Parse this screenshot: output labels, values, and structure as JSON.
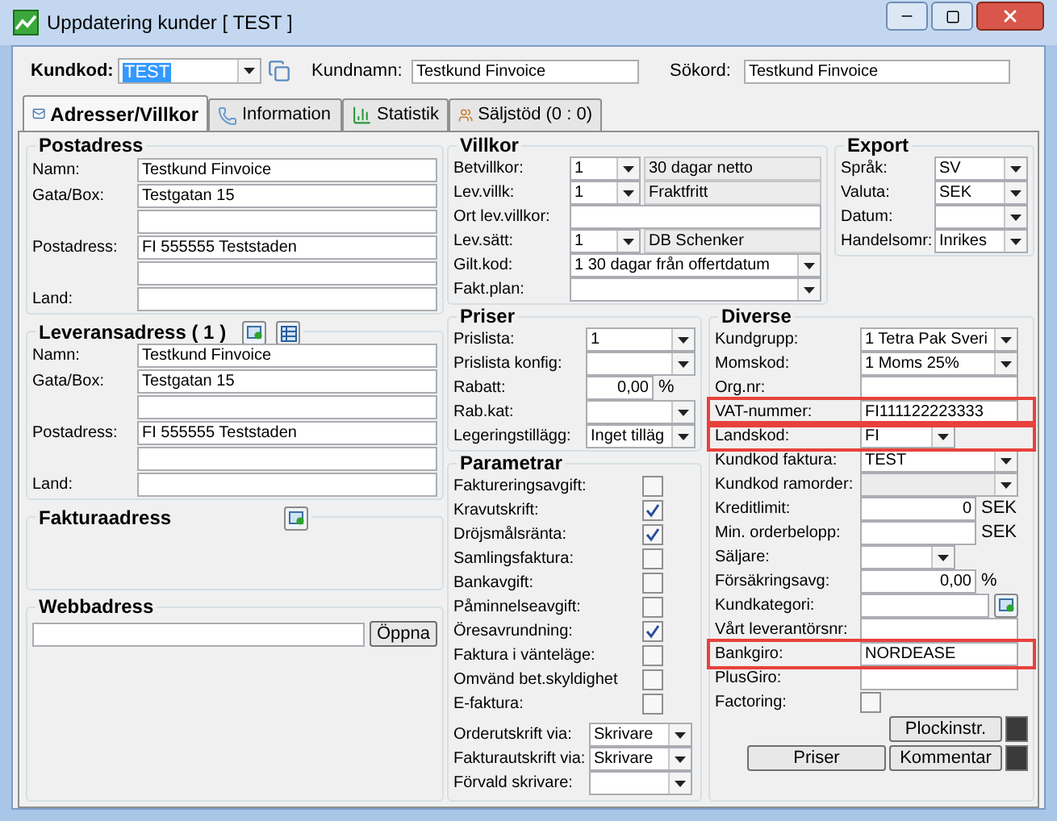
{
  "window": {
    "title": "Uppdatering kunder [ TEST ]"
  },
  "header": {
    "kundkod": {
      "label": "Kundkod:",
      "value": "TEST"
    },
    "kundnamn": {
      "label": "Kundnamn:",
      "value": "Testkund Finvoice"
    },
    "sokord": {
      "label": "Sökord:",
      "value": "Testkund Finvoice"
    }
  },
  "tabs": [
    {
      "label": "Adresser/Villkor",
      "selected": true,
      "kind": "mail"
    },
    {
      "label": "Information",
      "selected": false,
      "kind": "phone"
    },
    {
      "label": "Statistik",
      "selected": false,
      "kind": "chart"
    },
    {
      "label": "Säljstöd (0 : 0)",
      "selected": false,
      "kind": "people"
    }
  ],
  "postadress": {
    "title": "Postadress",
    "rows": [
      {
        "label": "Namn:",
        "value": "Testkund Finvoice"
      },
      {
        "label": "Gata/Box:",
        "value": "Testgatan 15"
      },
      {},
      {
        "label": "Postadress:",
        "value": "FI 555555 Teststaden"
      },
      {},
      {
        "label": "Land:"
      }
    ]
  },
  "leveransadress": {
    "title": "Leveransadress ( 1 )",
    "rows": [
      {
        "label": "Namn:",
        "value": "Testkund Finvoice"
      },
      {
        "label": "Gata/Box:",
        "value": "Testgatan 15"
      },
      {},
      {
        "label": "Postadress:",
        "value": "FI 555555 Teststaden"
      },
      {},
      {
        "label": "Land:"
      }
    ]
  },
  "fakturaadress": {
    "title": "Fakturaadress"
  },
  "webbadress": {
    "title": "Webbadress",
    "button": "Öppna"
  },
  "villkor": {
    "title": "Villkor",
    "rows": [
      {
        "kind": "code",
        "label": "Betvillkor:",
        "value": "1",
        "text": "30 dagar netto"
      },
      {
        "kind": "code",
        "label": "Lev.villk:",
        "value": "1",
        "text": "Fraktfritt"
      },
      {
        "kind": "text",
        "label": "Ort lev.villkor:"
      },
      {
        "kind": "code",
        "label": "Lev.sätt:",
        "value": "1",
        "text": "DB Schenker"
      },
      {
        "kind": "combo",
        "label": "Gilt.kod:",
        "value": "1 30 dagar från offertdatum"
      },
      {
        "kind": "combo",
        "label": "Fakt.plan:"
      }
    ]
  },
  "export": {
    "title": "Export",
    "rows": [
      {
        "kind": "combo",
        "label": "Språk:",
        "value": "SV"
      },
      {
        "kind": "combo",
        "label": "Valuta:",
        "value": "SEK"
      },
      {
        "kind": "combo",
        "label": "Datum:"
      },
      {
        "kind": "combo",
        "label": "Handelsomr:",
        "value": "Inrikes"
      }
    ]
  },
  "priser": {
    "title": "Priser",
    "rows": [
      {
        "kind": "combo",
        "label": "Prislista:",
        "value": "1"
      },
      {
        "kind": "combo",
        "label": "Prislista konfig:"
      },
      {
        "kind": "number",
        "label": "Rabatt:",
        "value": "0,00",
        "unit": "%"
      },
      {
        "kind": "combo",
        "label": "Rab.kat:"
      },
      {
        "kind": "combo",
        "label": "Legeringstillägg:",
        "value": "Inget tilläg"
      }
    ]
  },
  "parametrar": {
    "title": "Parametrar",
    "rows": [
      {
        "kind": "checkbox",
        "label": "Faktureringsavgift:",
        "checked": false
      },
      {
        "kind": "checkbox",
        "label": "Kravutskrift:",
        "checked": true
      },
      {
        "kind": "checkbox",
        "label": "Dröjsmålsränta:",
        "checked": true
      },
      {
        "kind": "checkbox",
        "label": "Samlingsfaktura:",
        "checked": false
      },
      {
        "kind": "checkbox",
        "label": "Bankavgift:",
        "checked": false
      },
      {
        "kind": "checkbox",
        "label": "Påminnelseavgift:",
        "checked": false
      },
      {
        "kind": "checkbox",
        "label": "Öresavrundning:",
        "checked": true
      },
      {
        "kind": "checkbox",
        "label": "Faktura i vänteläge:",
        "checked": false
      },
      {
        "kind": "checkbox",
        "label": "Omvänd bet.skyldighet",
        "checked": false
      },
      {
        "kind": "checkbox",
        "label": "E-faktura:",
        "checked": false
      }
    ],
    "printers": [
      {
        "kind": "combo",
        "label": "Orderutskrift via:",
        "value": "Skrivare"
      },
      {
        "kind": "combo",
        "label": "Fakturautskrift via:",
        "value": "Skrivare"
      },
      {
        "kind": "combo",
        "label": "Förvald skrivare:"
      }
    ]
  },
  "diverse": {
    "title": "Diverse",
    "rows": [
      {
        "kind": "combo",
        "label": "Kundgrupp:",
        "value": "1 Tetra Pak Sveri",
        "highlighted": false
      },
      {
        "kind": "combo",
        "label": "Momskod:",
        "value": "1 Moms 25%",
        "highlighted": false
      },
      {
        "kind": "text",
        "label": "Org.nr:",
        "highlighted": false
      },
      {
        "kind": "text",
        "label": "VAT-nummer:",
        "value": "FI111122223333",
        "highlighted": true
      },
      {
        "kind": "shortcombo",
        "label": "Landskod:",
        "value": "FI",
        "highlighted": true
      },
      {
        "kind": "combo",
        "label": "Kundkod faktura:",
        "value": "TEST",
        "highlighted": false
      },
      {
        "kind": "disabledcombo",
        "label": "Kundkod ramorder:",
        "highlighted": false
      },
      {
        "kind": "number",
        "label": "Kreditlimit:",
        "value": "0",
        "unit": "SEK",
        "highlighted": false
      },
      {
        "kind": "number",
        "label": "Min. orderbelopp:",
        "unit": "SEK",
        "highlighted": false
      },
      {
        "kind": "shortcombo",
        "label": "Säljare:",
        "highlighted": false
      },
      {
        "kind": "number",
        "label": "Försäkringsavg:",
        "value": "0,00",
        "unit": "%",
        "highlighted": false
      },
      {
        "kind": "textadd",
        "label": "Kundkategori:",
        "highlighted": false
      },
      {
        "kind": "text",
        "label": "Vårt leverantörsnr:",
        "highlighted": false
      },
      {
        "kind": "text",
        "label": "Bankgiro:",
        "value": "NORDEASE",
        "highlighted": true
      },
      {
        "kind": "text",
        "label": "PlusGiro:",
        "highlighted": false
      },
      {
        "kind": "checkbox",
        "label": "Factoring:",
        "checked": false,
        "highlighted": false
      }
    ],
    "buttons": {
      "plockinstr": "Plockinstr.",
      "priser": "Priser",
      "kommentar": "Kommentar"
    }
  }
}
